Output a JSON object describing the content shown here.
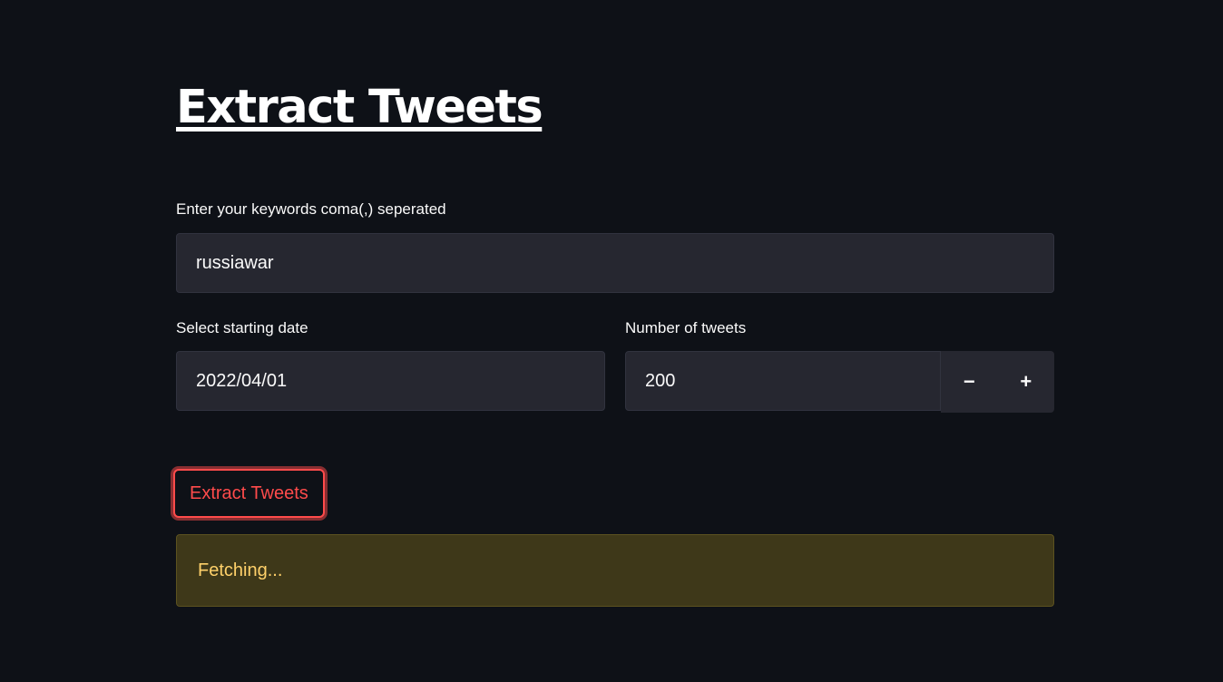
{
  "title": "Extract Tweets",
  "keywords": {
    "label": "Enter your keywords coma(,) seperated",
    "value": "russiawar"
  },
  "start_date": {
    "label": "Select starting date",
    "value": "2022/04/01"
  },
  "tweet_count": {
    "label": "Number of tweets",
    "value": "200",
    "decrement": "−",
    "increment": "+"
  },
  "submit_button": "Extract Tweets",
  "status": "Fetching..."
}
